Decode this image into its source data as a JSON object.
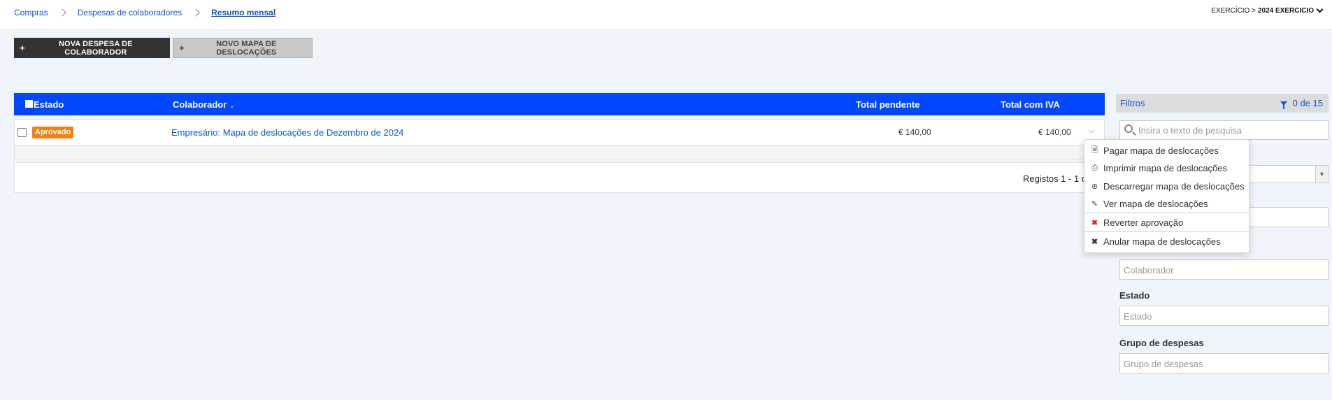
{
  "breadcrumb": {
    "items": [
      "Compras",
      "Despesas de colaboradores"
    ],
    "current": "Resumo mensal"
  },
  "exercise": {
    "label": "EXERCÍCIO >",
    "value": "2024 EXERCICIO",
    "icon": "chevron-down-icon"
  },
  "toolbar": {
    "new_expense_label": "NOVA DESPESA DE COLABORADOR",
    "new_map_label": "NOVO MAPA DE DESLOCAÇÕES",
    "plus_icon": "+"
  },
  "table": {
    "columns": {
      "estado": "Estado",
      "colaborador": "Colaborador",
      "sort_indicator": "⌄",
      "total_pendente": "Total pendente",
      "total_com_iva": "Total com IVA"
    },
    "rows": [
      {
        "status": "Aprovado",
        "description": "Empresário: Mapa de deslocações de Dezembro de 2024",
        "total_pendente": "€ 140,00",
        "total_com_iva": "€ 140,00"
      }
    ],
    "footer": "Registos 1 - 1 d",
    "colors": {
      "header": "#0048ff",
      "status_badge": "#f0820f"
    }
  },
  "context_menu": {
    "items": [
      {
        "label": "Pagar mapa de deslocações",
        "icon": "file-icon"
      },
      {
        "label": "Imprimir mapa de deslocações",
        "icon": "print-icon"
      },
      {
        "label": "Descarregar mapa de deslocações",
        "icon": "download-icon"
      },
      {
        "label": "Ver mapa de deslocações",
        "icon": "pencil-icon"
      },
      {
        "label": "Reverter aprovação",
        "icon": "revert-x-icon"
      },
      {
        "label": "Anular mapa de deslocações",
        "icon": "cancel-x-icon"
      }
    ]
  },
  "filters": {
    "title": "Filtros",
    "count": "0 de 15",
    "search_placeholder": "Insira o texto de pesquisa",
    "colaborador_placeholder": "Colaborador",
    "estado_label": "Estado",
    "estado_placeholder": "Estado",
    "grupo_label": "Grupo de despesas",
    "grupo_placeholder": "Grupo de despesas"
  }
}
